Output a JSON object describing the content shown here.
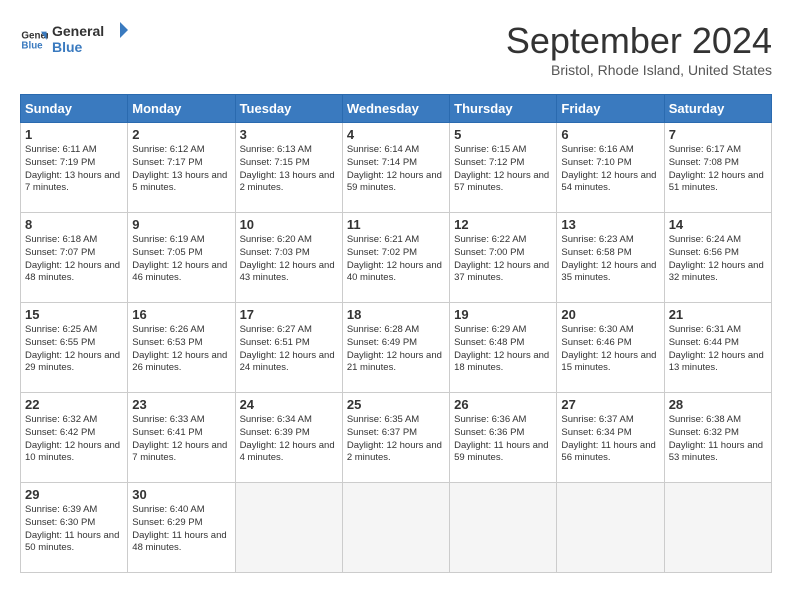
{
  "header": {
    "logo_line1": "General",
    "logo_line2": "Blue",
    "month_title": "September 2024",
    "location": "Bristol, Rhode Island, United States"
  },
  "weekdays": [
    "Sunday",
    "Monday",
    "Tuesday",
    "Wednesday",
    "Thursday",
    "Friday",
    "Saturday"
  ],
  "weeks": [
    [
      {
        "day": "1",
        "sunrise": "6:11 AM",
        "sunset": "7:19 PM",
        "daylight": "13 hours and 7 minutes."
      },
      {
        "day": "2",
        "sunrise": "6:12 AM",
        "sunset": "7:17 PM",
        "daylight": "13 hours and 5 minutes."
      },
      {
        "day": "3",
        "sunrise": "6:13 AM",
        "sunset": "7:15 PM",
        "daylight": "13 hours and 2 minutes."
      },
      {
        "day": "4",
        "sunrise": "6:14 AM",
        "sunset": "7:14 PM",
        "daylight": "12 hours and 59 minutes."
      },
      {
        "day": "5",
        "sunrise": "6:15 AM",
        "sunset": "7:12 PM",
        "daylight": "12 hours and 57 minutes."
      },
      {
        "day": "6",
        "sunrise": "6:16 AM",
        "sunset": "7:10 PM",
        "daylight": "12 hours and 54 minutes."
      },
      {
        "day": "7",
        "sunrise": "6:17 AM",
        "sunset": "7:08 PM",
        "daylight": "12 hours and 51 minutes."
      }
    ],
    [
      {
        "day": "8",
        "sunrise": "6:18 AM",
        "sunset": "7:07 PM",
        "daylight": "12 hours and 48 minutes."
      },
      {
        "day": "9",
        "sunrise": "6:19 AM",
        "sunset": "7:05 PM",
        "daylight": "12 hours and 46 minutes."
      },
      {
        "day": "10",
        "sunrise": "6:20 AM",
        "sunset": "7:03 PM",
        "daylight": "12 hours and 43 minutes."
      },
      {
        "day": "11",
        "sunrise": "6:21 AM",
        "sunset": "7:02 PM",
        "daylight": "12 hours and 40 minutes."
      },
      {
        "day": "12",
        "sunrise": "6:22 AM",
        "sunset": "7:00 PM",
        "daylight": "12 hours and 37 minutes."
      },
      {
        "day": "13",
        "sunrise": "6:23 AM",
        "sunset": "6:58 PM",
        "daylight": "12 hours and 35 minutes."
      },
      {
        "day": "14",
        "sunrise": "6:24 AM",
        "sunset": "6:56 PM",
        "daylight": "12 hours and 32 minutes."
      }
    ],
    [
      {
        "day": "15",
        "sunrise": "6:25 AM",
        "sunset": "6:55 PM",
        "daylight": "12 hours and 29 minutes."
      },
      {
        "day": "16",
        "sunrise": "6:26 AM",
        "sunset": "6:53 PM",
        "daylight": "12 hours and 26 minutes."
      },
      {
        "day": "17",
        "sunrise": "6:27 AM",
        "sunset": "6:51 PM",
        "daylight": "12 hours and 24 minutes."
      },
      {
        "day": "18",
        "sunrise": "6:28 AM",
        "sunset": "6:49 PM",
        "daylight": "12 hours and 21 minutes."
      },
      {
        "day": "19",
        "sunrise": "6:29 AM",
        "sunset": "6:48 PM",
        "daylight": "12 hours and 18 minutes."
      },
      {
        "day": "20",
        "sunrise": "6:30 AM",
        "sunset": "6:46 PM",
        "daylight": "12 hours and 15 minutes."
      },
      {
        "day": "21",
        "sunrise": "6:31 AM",
        "sunset": "6:44 PM",
        "daylight": "12 hours and 13 minutes."
      }
    ],
    [
      {
        "day": "22",
        "sunrise": "6:32 AM",
        "sunset": "6:42 PM",
        "daylight": "12 hours and 10 minutes."
      },
      {
        "day": "23",
        "sunrise": "6:33 AM",
        "sunset": "6:41 PM",
        "daylight": "12 hours and 7 minutes."
      },
      {
        "day": "24",
        "sunrise": "6:34 AM",
        "sunset": "6:39 PM",
        "daylight": "12 hours and 4 minutes."
      },
      {
        "day": "25",
        "sunrise": "6:35 AM",
        "sunset": "6:37 PM",
        "daylight": "12 hours and 2 minutes."
      },
      {
        "day": "26",
        "sunrise": "6:36 AM",
        "sunset": "6:36 PM",
        "daylight": "11 hours and 59 minutes."
      },
      {
        "day": "27",
        "sunrise": "6:37 AM",
        "sunset": "6:34 PM",
        "daylight": "11 hours and 56 minutes."
      },
      {
        "day": "28",
        "sunrise": "6:38 AM",
        "sunset": "6:32 PM",
        "daylight": "11 hours and 53 minutes."
      }
    ],
    [
      {
        "day": "29",
        "sunrise": "6:39 AM",
        "sunset": "6:30 PM",
        "daylight": "11 hours and 50 minutes."
      },
      {
        "day": "30",
        "sunrise": "6:40 AM",
        "sunset": "6:29 PM",
        "daylight": "11 hours and 48 minutes."
      },
      null,
      null,
      null,
      null,
      null
    ]
  ]
}
